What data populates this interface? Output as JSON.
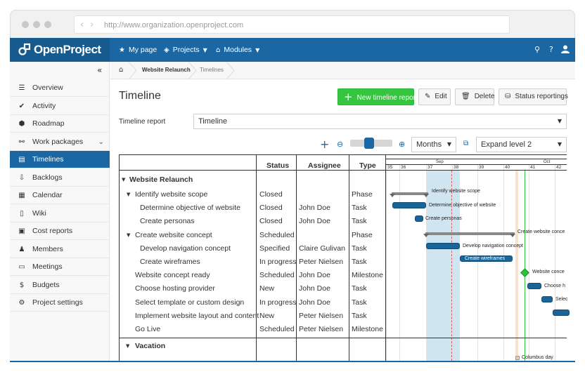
{
  "browser": {
    "url": "http://www.organization.openproject.com",
    "back": "‹",
    "forward": "›"
  },
  "header": {
    "logo": "OpenProject",
    "nav": [
      {
        "icon": "★",
        "label": "My page"
      },
      {
        "icon": "◈",
        "label": "Projects"
      },
      {
        "icon": "⌂",
        "label": "Modules"
      }
    ],
    "search_icon": "⚲",
    "help": "?",
    "user_icon": "👤"
  },
  "sidebar": {
    "collapse": "«",
    "items": [
      {
        "icon": "☰",
        "label": "Overview"
      },
      {
        "icon": "✔",
        "label": "Activity"
      },
      {
        "icon": "⬢",
        "label": "Roadmap"
      },
      {
        "icon": "⚯",
        "label": "Work packages",
        "chevron": "⌄"
      },
      {
        "icon": "▤",
        "label": "Timelines"
      },
      {
        "icon": "⇩",
        "label": "Backlogs"
      },
      {
        "icon": "▦",
        "label": "Calendar"
      },
      {
        "icon": "▯",
        "label": "Wiki"
      },
      {
        "icon": "▣",
        "label": "Cost reports"
      },
      {
        "icon": "♟",
        "label": "Members"
      },
      {
        "icon": "▭",
        "label": "Meetings"
      },
      {
        "icon": "$",
        "label": "Budgets"
      },
      {
        "icon": "⚙",
        "label": "Project settings"
      }
    ]
  },
  "breadcrumb": {
    "home": "⌂",
    "items": [
      "Website Relaunch",
      "Timelines"
    ]
  },
  "main": {
    "title": "Timeline",
    "buttons": {
      "new_report": "New timeline report",
      "new_icon": "+",
      "edit": "Edit",
      "edit_icon": "✎",
      "delete": "Delete",
      "delete_icon": "🗑",
      "status": "Status reportings",
      "status_icon": "⛁"
    },
    "report_label": "Timeline report",
    "report_value": "Timeline",
    "zoom_value": "Months",
    "expand_value": "Expand level 2",
    "arrow": "▼",
    "plus": "+",
    "zoom_out_icon": "⊖",
    "zoom_in_icon": "⊕",
    "expand_icon": "⧉"
  },
  "table": {
    "headers": {
      "status": "Status",
      "assignee": "Assignee",
      "type": "Type"
    },
    "group1": "Website Relaunch",
    "rows": [
      {
        "name": "Identify website scope",
        "status": "Closed",
        "assignee": "",
        "type": "Phase"
      },
      {
        "name": "Determine objective of website",
        "status": "Closed",
        "assignee": "John Doe",
        "type": "Task"
      },
      {
        "name": "Create personas",
        "status": "Closed",
        "assignee": "John Doe",
        "type": "Task"
      },
      {
        "name": "Create website concept",
        "status": "Scheduled",
        "assignee": "",
        "type": "Phase"
      },
      {
        "name": "Develop navigation concept",
        "status": "Specified",
        "assignee": "Claire Gulivan",
        "type": "Task"
      },
      {
        "name": "Create wireframes",
        "status": "In progress",
        "assignee": "Peter Nielsen",
        "type": "Task"
      },
      {
        "name": "Website concept ready",
        "status": "Scheduled",
        "assignee": "John Doe",
        "type": "Milestone"
      },
      {
        "name": "Choose hosting provider",
        "status": "New",
        "assignee": "John Doe",
        "type": "Task"
      },
      {
        "name": "Select template or custom design",
        "status": "In progress",
        "assignee": "John Doe",
        "type": "Task"
      },
      {
        "name": "Implement website layout and content",
        "status": "New",
        "assignee": "Peter Nielsen",
        "type": "Task"
      },
      {
        "name": "Go Live",
        "status": "Scheduled",
        "assignee": "Peter Nielsen",
        "type": "Milestone"
      }
    ],
    "group2": "Vacation",
    "expander": "▼"
  },
  "gantt": {
    "months": [
      "Sep",
      "Oct"
    ],
    "weeks": [
      "35",
      "36",
      "37",
      "38",
      "39",
      "40",
      "41",
      "42"
    ],
    "labels": {
      "identify": "Identify website scope",
      "determine": "Determine objective of website",
      "personas": "Create personas",
      "concept": "Create website conce",
      "navigation": "Develop navigation concept",
      "wireframes": "Create wireframes",
      "ready": "Website conce",
      "hosting": "Choose h",
      "select": "Selec",
      "columbus": "Columbus day"
    }
  }
}
